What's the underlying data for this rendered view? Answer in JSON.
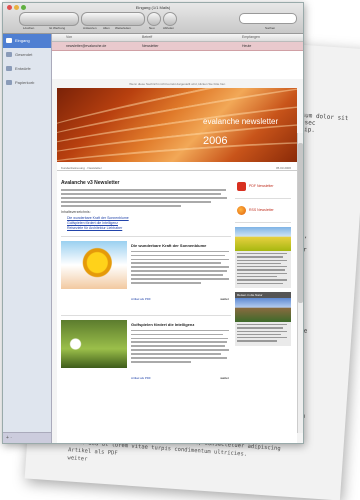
{
  "window": {
    "title": "Eingang (1/1 Mails)"
  },
  "toolbar": {
    "labels": [
      "Löschen",
      "Ist Werbung",
      "Antworten",
      "Allen",
      "Weiterleiten",
      "Neu",
      "Abholen",
      "Suchen"
    ],
    "search_placeholder": ""
  },
  "sidebar": {
    "items": [
      {
        "label": "Eingang",
        "selected": true
      },
      {
        "label": "Gesendet",
        "selected": false
      },
      {
        "label": "Entwürfe",
        "selected": false
      },
      {
        "label": "Papierkorb",
        "selected": false
      }
    ],
    "add_label": "+ ·"
  },
  "list": {
    "headers": {
      "from": "Von",
      "subject": "Betreff",
      "date": "Empfangen"
    },
    "message": {
      "from": "newsletter@evalanche.de",
      "subject": "Newsletter",
      "date": "Heute"
    }
  },
  "newsletter": {
    "top_line": "Wenn diese Nachricht nicht korrekt dargestellt wird, klicken Sie bitte hier.",
    "brand": "evalanche newsletter",
    "year": "2006",
    "meta_left": "Kundenbetreuung · Newsletter",
    "meta_right": "05.03.2006",
    "heading": "Avalanche v3 Newsletter",
    "links_head": "Inhaltsverzeichnis:",
    "links": [
      "Die wunderbare Kraft der Sonnenblume",
      "Golfspielen fördert die Intelligenz",
      "Reiseziele für Architektur Liebhaber"
    ],
    "articles": [
      {
        "title": "Die wunderbare Kraft der Sonnenblume",
        "foot": "Artikel als PDF",
        "more": "weiter"
      },
      {
        "title": "Golfspielen fördert die Intelligenz",
        "foot": "Artikel als PDF",
        "more": "weiter"
      }
    ],
    "side": {
      "pdf_label": "PDF Newsletter",
      "rss_label": "RSS Newsletter",
      "box2_head": "Reisen in die Natur"
    }
  },
  "paper": {
    "footer_lines": [
      "sum s illum. Lorem ipsum dolor sit amet, consectetuer adipiscing",
      "elit. Sed ut lorem vitae turpis condimentum ultricies.",
      "Artikel als PDF",
      "weiter"
    ]
  },
  "colors": {
    "accent": "#4f7fd2",
    "selected_message": "#e9c9cd",
    "banner": "#c8541a"
  }
}
